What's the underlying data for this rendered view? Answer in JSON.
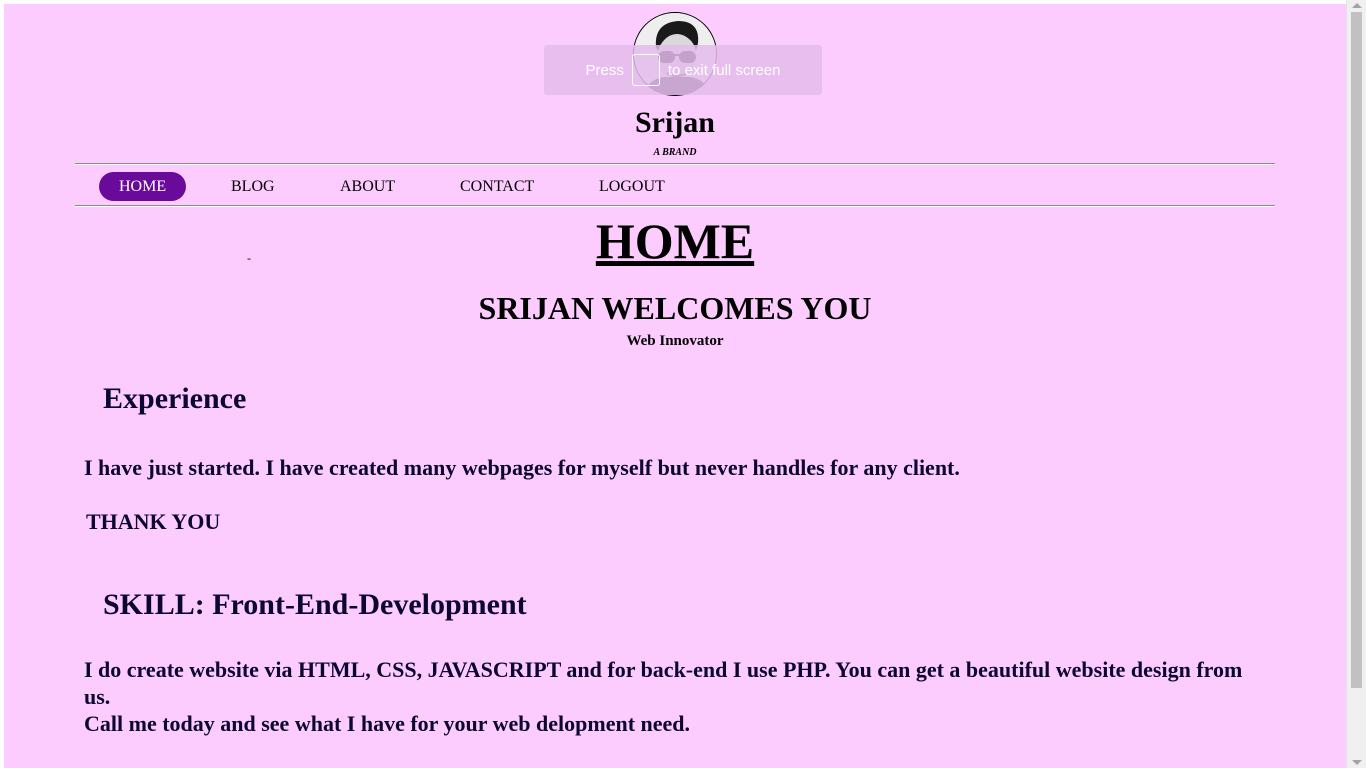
{
  "fullscreen_notice": {
    "before": "Press",
    "after": "to exit full screen"
  },
  "brand": {
    "name": "Srijan",
    "tagline": "A BRAND"
  },
  "nav": {
    "items": [
      {
        "label": "HOME",
        "active": true
      },
      {
        "label": "BLOG"
      },
      {
        "label": "ABOUT"
      },
      {
        "label": "CONTACT"
      },
      {
        "label": "LOGOUT"
      }
    ]
  },
  "main": {
    "stray_mark": "-",
    "page_title": "HOME",
    "welcome": "SRIJAN WELCOMES YOU",
    "subtitle": "Web Innovator",
    "experience": {
      "heading": "Experience",
      "text": "I have just started. I have created many webpages for myself but never handles for any client.",
      "closing": "THANK YOU"
    },
    "skill": {
      "heading": "SKILL: Front-End-Development",
      "text_line1": "I do create website via HTML, CSS, JAVASCRIPT and for back-end I use PHP. You can get a beautiful website design from us.",
      "text_line2": "Call me today and see what I have for your web delopment need."
    }
  },
  "colors": {
    "page_background": "#fdccfe",
    "nav_active": "#6a0a9a",
    "body_text": "#0c0732"
  },
  "icons": {
    "avatar": "profile-photo"
  }
}
